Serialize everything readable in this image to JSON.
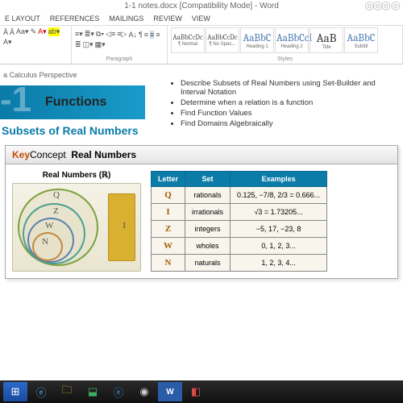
{
  "window": {
    "title": "1-1 notes.docx [Compatibility Mode] - Word"
  },
  "tabs": {
    "t1": "E LAYOUT",
    "t2": "REFERENCES",
    "t3": "MAILINGS",
    "t4": "REVIEW",
    "t5": "VIEW"
  },
  "ribbon": {
    "paragraph_label": "Paragraph",
    "styles_label": "Styles",
    "styles": [
      {
        "sample": "AaBbCcDc",
        "name": "¶ Normal"
      },
      {
        "sample": "AaBbCcDc",
        "name": "¶ No Spac..."
      },
      {
        "sample": "AaBbC",
        "name": "Heading 1"
      },
      {
        "sample": "AaBbCcl",
        "name": "Heading 2"
      },
      {
        "sample": "AaB",
        "name": "Title"
      },
      {
        "sample": "AaBbC",
        "name": "Subtitl"
      }
    ]
  },
  "doc": {
    "subtitle": "a Calculus Perspective",
    "banner_num": "-1",
    "banner_text": "Functions",
    "section": "Subsets of Real Numbers",
    "objectives": [
      "Describe Subsets of Real Numbers using Set-Builder and Interval Notation",
      "Determine when a relation is a function",
      "Find Function Values",
      "Find Domains Algebraically"
    ],
    "kc_key": "Key",
    "kc_concept": "Concept",
    "kc_title": "Real Numbers",
    "venn_title": "Real Numbers (ℝ)",
    "table": {
      "h1": "Letter",
      "h2": "Set",
      "h3": "Examples",
      "rows": [
        {
          "l": "Q",
          "s": "rationals",
          "e": "0.125, −7/8, 2/3 = 0.666..."
        },
        {
          "l": "I",
          "s": "irrationals",
          "e": "√3 = 1.73205..."
        },
        {
          "l": "Z",
          "s": "integers",
          "e": "−5, 17, −23, 8"
        },
        {
          "l": "W",
          "s": "wholes",
          "e": "0, 1, 2, 3..."
        },
        {
          "l": "N",
          "s": "naturals",
          "e": "1, 2, 3, 4..."
        }
      ]
    }
  }
}
